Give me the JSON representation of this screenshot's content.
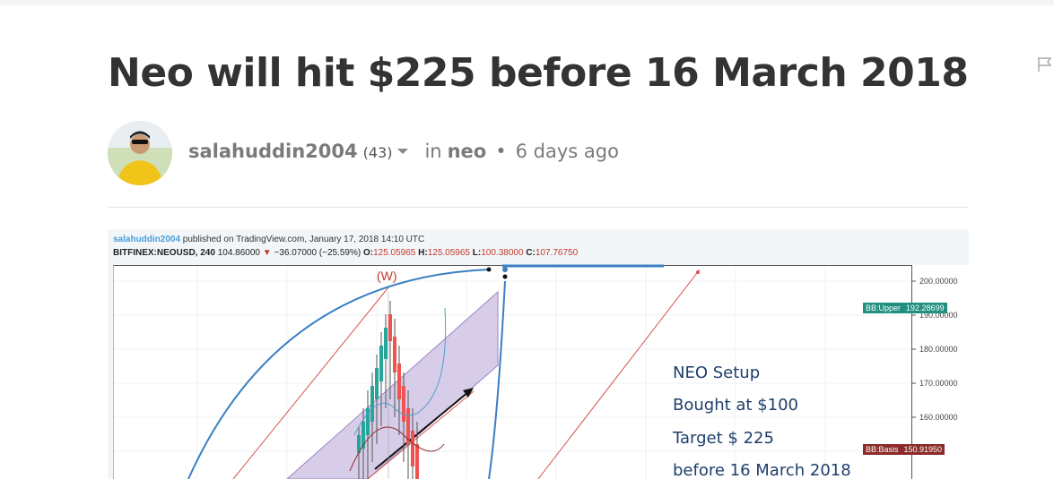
{
  "post": {
    "title": "Neo will hit $225 before 16 March 2018",
    "author": "salahuddin2004",
    "reputation": "(43)",
    "in_label": "in",
    "category": "neo",
    "separator": "•",
    "time": "6 days ago"
  },
  "chart": {
    "publisher": "salahuddin2004",
    "published_text": " published on TradingView.com, January 17, 2018 14:10 UTC",
    "symbol": "BITFINEX:NEOUSD, 240",
    "last": "104.86000",
    "change_arrow": "▼",
    "change": "−36.07000 (−25.59%)",
    "o_label": "O:",
    "o_value": "125.05965",
    "h_label": "H:",
    "h_value": "125.05965",
    "l_label": "L:",
    "l_value": "100.38000",
    "c_label": "C:",
    "c_value": "107.76750",
    "wave_label": "(W)",
    "price_ticks": [
      "200.00000",
      "190.00000",
      "180.00000",
      "170.00000",
      "160.00000"
    ],
    "bb_upper_label": "BB:Upper",
    "bb_upper_value": "192.28699",
    "bb_basis_label": "BB:Basis",
    "bb_basis_value": "150.91950",
    "bb_upper_color": "#1f8f7f",
    "bb_basis_color": "#8b2a2a",
    "notes": [
      "NEO Setup",
      "Bought at $100",
      "Target $ 225",
      "before 16 March 2018"
    ]
  },
  "icons": {
    "flag": "flag-icon",
    "caret": "caret-down-icon"
  }
}
